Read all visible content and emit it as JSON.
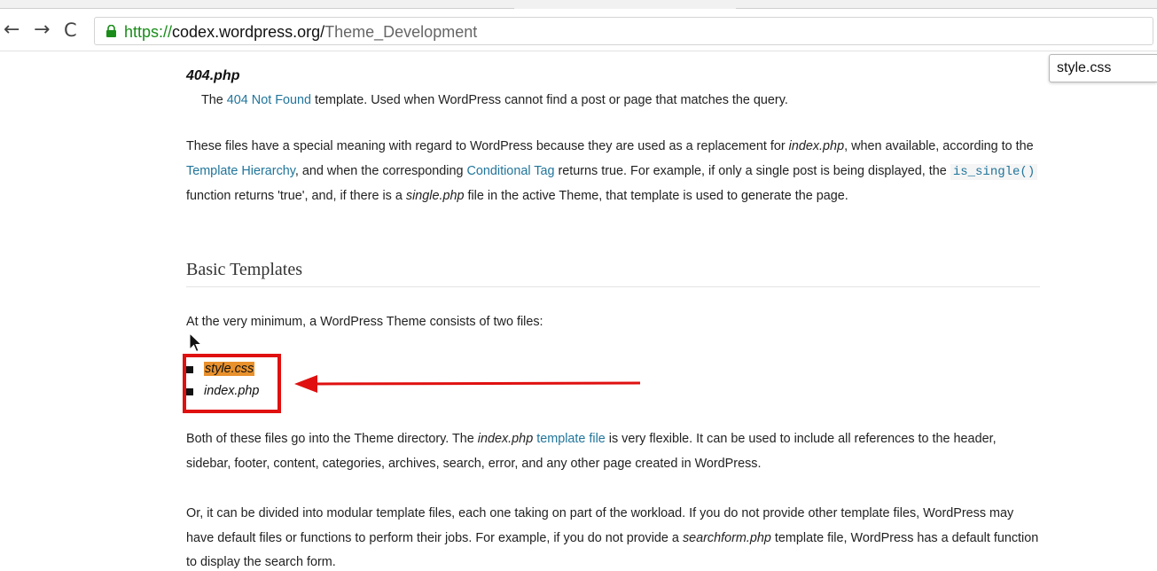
{
  "browser": {
    "url_scheme": "https://",
    "url_domain": "codex.wordpress.org/",
    "url_path": "Theme_Development",
    "back_icon": "arrow-left-icon",
    "forward_icon": "arrow-right-icon",
    "reload_icon": "reload-icon"
  },
  "find": {
    "query": "style.css"
  },
  "content": {
    "filename": "404.php",
    "desc_pre": "The ",
    "desc_link": "404 Not Found",
    "desc_post": " template. Used when WordPress cannot find a post or page that matches the query.",
    "para1": {
      "t1": "These files have a special meaning with regard to WordPress because they are used as a replacement for ",
      "em1": "index.php",
      "t2": ", when available, according to the ",
      "link1": "Template Hierarchy",
      "t3": ", and when the corresponding ",
      "link2": "Conditional Tag",
      "t4": " returns true. For example, if only a single post is being displayed, the ",
      "code": "is_single()",
      "t5": " function returns 'true', and, if there is a ",
      "em2": "single.php",
      "t6": " file in the active Theme, that template is used to generate the page."
    },
    "heading": "Basic Templates",
    "para2": "At the very minimum, a WordPress Theme consists of two files:",
    "files": [
      "style.css",
      "index.php"
    ],
    "para3": {
      "t1": "Both of these files go into the Theme directory. The ",
      "em": "index.php",
      "t2": " ",
      "link": "template file",
      "t3": " is very flexible. It can be used to include all references to the header, sidebar, footer, content, categories, archives, search, error, and any other page created in WordPress."
    },
    "para4": {
      "t1": "Or, it can be divided into modular template files, each one taking on part of the workload. If you do not provide other template files, WordPress may have default files or functions to perform their jobs. For example, if you do not provide a ",
      "em": "searchform.php",
      "t2": " template file, WordPress has a default function to display the search form."
    }
  },
  "colors": {
    "link": "#21759b",
    "annotation": "#e01010",
    "find_highlight": "#e8912d",
    "secure_scheme": "#1a8c1a"
  }
}
